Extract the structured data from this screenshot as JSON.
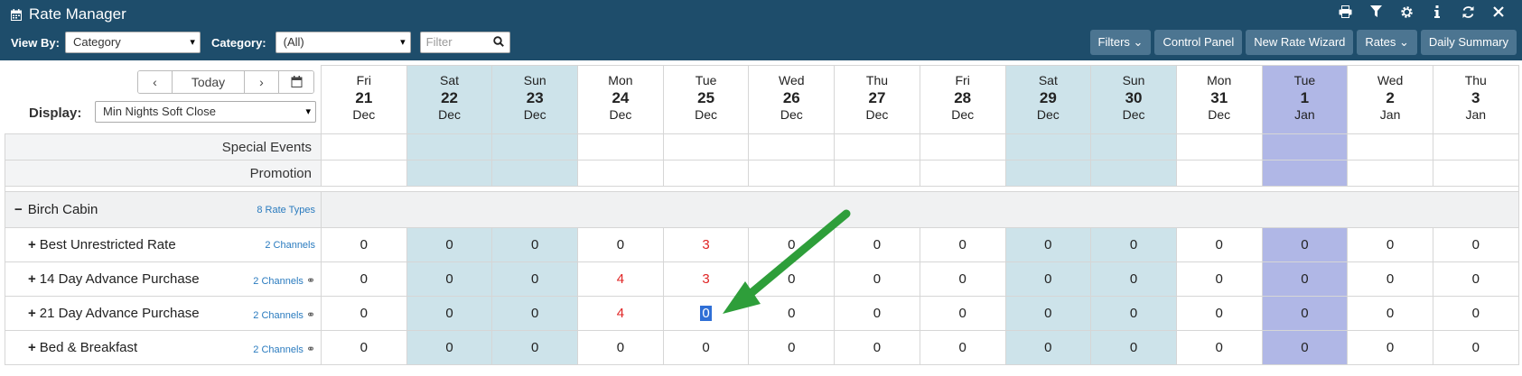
{
  "header": {
    "title": "Rate Manager",
    "view_by_label": "View By:",
    "view_by_value": "Category",
    "category_label": "Category:",
    "category_value": "(All)",
    "filter_placeholder": "Filter",
    "buttons": [
      "Filters",
      "Control Panel",
      "New Rate Wizard",
      "Rates",
      "Daily Summary"
    ]
  },
  "nav": {
    "today_label": "Today",
    "display_label": "Display:",
    "display_value": "Min Nights Soft Close"
  },
  "days": [
    {
      "dow": "Fri",
      "num": "21",
      "mon": "Dec"
    },
    {
      "dow": "Sat",
      "num": "22",
      "mon": "Dec"
    },
    {
      "dow": "Sun",
      "num": "23",
      "mon": "Dec"
    },
    {
      "dow": "Mon",
      "num": "24",
      "mon": "Dec"
    },
    {
      "dow": "Tue",
      "num": "25",
      "mon": "Dec"
    },
    {
      "dow": "Wed",
      "num": "26",
      "mon": "Dec"
    },
    {
      "dow": "Thu",
      "num": "27",
      "mon": "Dec"
    },
    {
      "dow": "Fri",
      "num": "28",
      "mon": "Dec"
    },
    {
      "dow": "Sat",
      "num": "29",
      "mon": "Dec"
    },
    {
      "dow": "Sun",
      "num": "30",
      "mon": "Dec"
    },
    {
      "dow": "Mon",
      "num": "31",
      "mon": "Dec"
    },
    {
      "dow": "Tue",
      "num": "1",
      "mon": "Jan"
    },
    {
      "dow": "Wed",
      "num": "2",
      "mon": "Jan"
    },
    {
      "dow": "Thu",
      "num": "3",
      "mon": "Jan"
    }
  ],
  "special_rows": [
    "Special Events",
    "Promotion"
  ],
  "group": {
    "name": "Birch Cabin",
    "rate_types": "8 Rate Types"
  },
  "rates": [
    {
      "name": "Best Unrestricted Rate",
      "channels": "2 Channels",
      "linked": false,
      "values": [
        "0",
        "0",
        "0",
        "0",
        "3",
        "0",
        "0",
        "0",
        "0",
        "0",
        "0",
        "0",
        "0",
        "0"
      ]
    },
    {
      "name": "14 Day Advance Purchase",
      "channels": "2 Channels",
      "linked": true,
      "values": [
        "0",
        "0",
        "0",
        "4",
        "3",
        "0",
        "0",
        "0",
        "0",
        "0",
        "0",
        "0",
        "0",
        "0"
      ]
    },
    {
      "name": "21 Day Advance Purchase",
      "channels": "2 Channels",
      "linked": true,
      "values": [
        "0",
        "0",
        "0",
        "4",
        "0",
        "0",
        "0",
        "0",
        "0",
        "0",
        "0",
        "0",
        "0",
        "0"
      ]
    },
    {
      "name": "Bed & Breakfast",
      "channels": "2 Channels",
      "linked": true,
      "values": [
        "0",
        "0",
        "0",
        "0",
        "0",
        "0",
        "0",
        "0",
        "0",
        "0",
        "0",
        "0",
        "0",
        "0"
      ]
    }
  ],
  "colors": {
    "header_bg": "#1e4d6b",
    "weekend": "#cde3ea",
    "today": "#b0b7e6",
    "highlight_red": "#e02424",
    "arrow_green": "#2e9e3a"
  }
}
